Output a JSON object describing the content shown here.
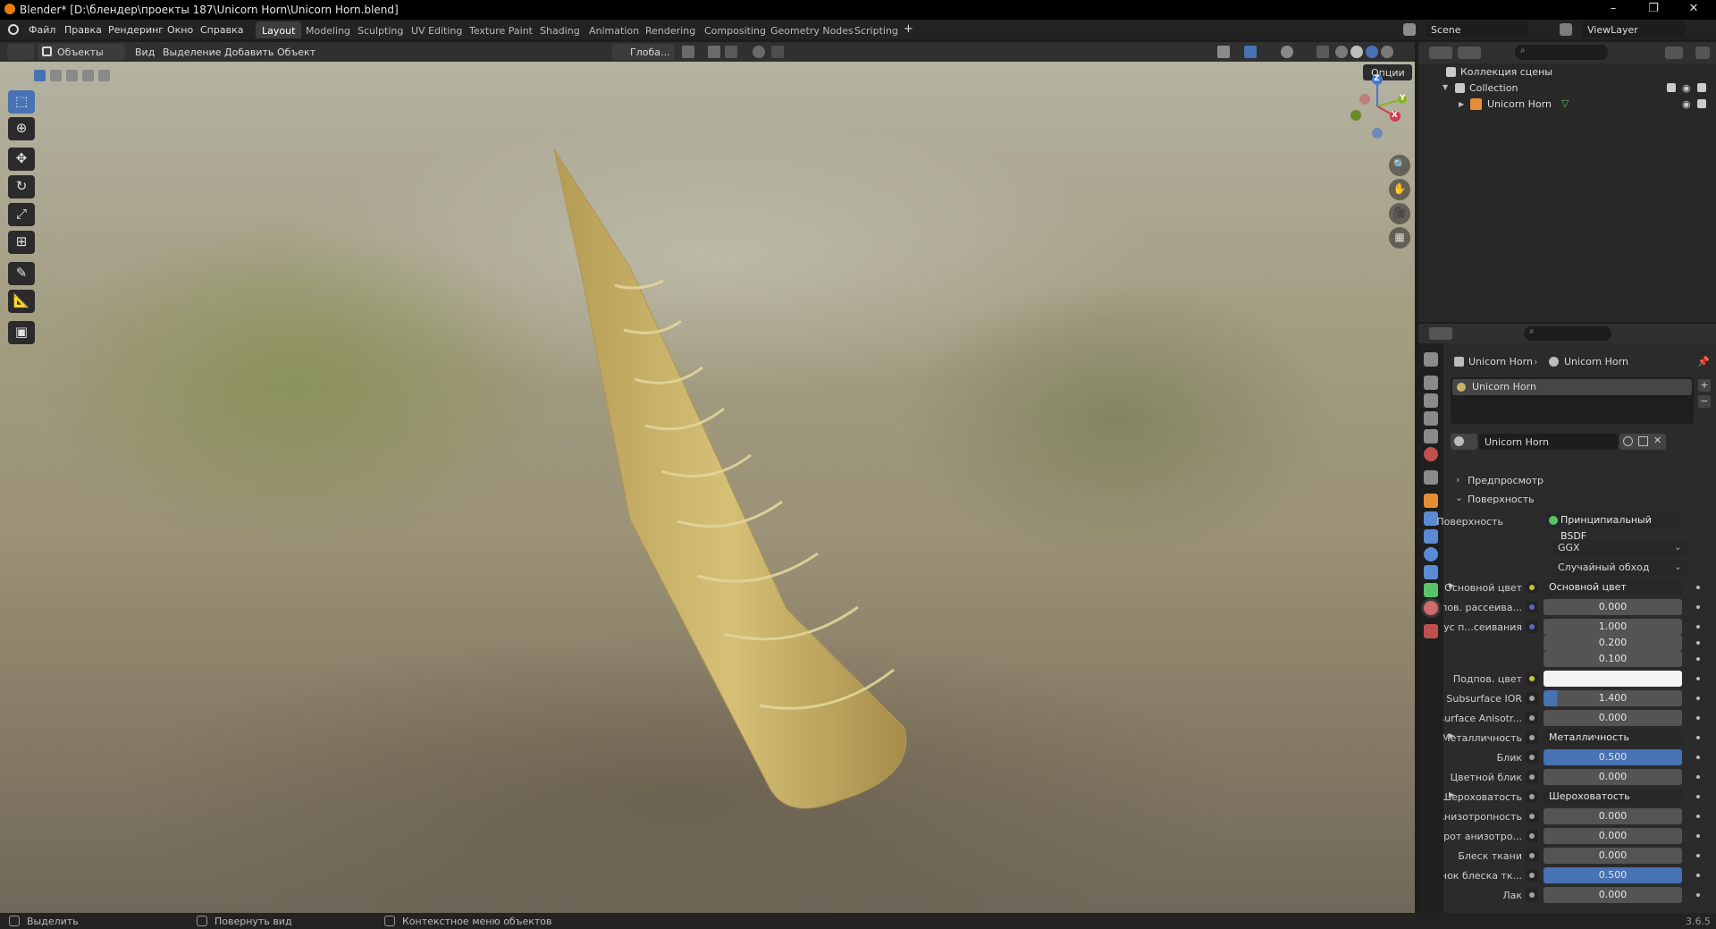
{
  "window": {
    "title": "Blender* [D:\\блендер\\проекты 187\\Unicorn Horn\\Unicorn Horn.blend]",
    "minimize": "–",
    "restore": "❐",
    "close": "✕"
  },
  "menu": [
    "Файл",
    "Правка",
    "Рендеринг",
    "Окно",
    "Справка"
  ],
  "workspaces": [
    {
      "label": "Layout",
      "active": true
    },
    {
      "label": "Modeling",
      "active": false
    },
    {
      "label": "Sculpting",
      "active": false
    },
    {
      "label": "UV Editing",
      "active": false
    },
    {
      "label": "Texture Paint",
      "active": false
    },
    {
      "label": "Shading",
      "active": false
    },
    {
      "label": "Animation",
      "active": false
    },
    {
      "label": "Rendering",
      "active": false
    },
    {
      "label": "Compositing",
      "active": false
    },
    {
      "label": "Geometry Nodes",
      "active": false
    },
    {
      "label": "Scripting",
      "active": false
    }
  ],
  "add_workspace": "+",
  "scene": {
    "label": "Scene",
    "view_layer": "ViewLayer"
  },
  "viewport_header": {
    "mode": "Объекты",
    "menus": [
      "Вид",
      "Выделение",
      "Добавить",
      "Объект"
    ],
    "transform_orientation": "Глоба...",
    "options": "Опции"
  },
  "gizmo": {
    "x": "X",
    "y": "Y",
    "z": "Z"
  },
  "outliner": {
    "root": "Коллекция сцены",
    "collection": "Collection",
    "object": "Unicorn Horn"
  },
  "properties": {
    "breadcrumb_object": "Unicorn Horn",
    "breadcrumb_material": "Unicorn Horn",
    "slot_material": "Unicorn Horn",
    "material_name": "Unicorn Horn",
    "sections": {
      "preview": "Предпросмотр",
      "surface": "Поверхность"
    },
    "surface_label": "Поверхность",
    "surface_value": "Принципиальный BSDF",
    "distribution": "GGX",
    "subsurface_method": "Случайный обход",
    "rows": [
      {
        "label": "Основной цвет",
        "kind": "link",
        "value": "Основной цвет",
        "socket": "#c7c729",
        "expander": true
      },
      {
        "label": "Подпов. рассеива...",
        "kind": "num",
        "value": "0.000",
        "socket": "#6363c7"
      },
      {
        "label": "Радиус п...сеивания",
        "kind": "num",
        "value": "1.000",
        "socket": "#6363c7"
      },
      {
        "label": "",
        "kind": "num",
        "value": "0.200",
        "socket": ""
      },
      {
        "label": "",
        "kind": "num",
        "value": "0.100",
        "socket": ""
      },
      {
        "label": "Подпов. цвет",
        "kind": "color",
        "value": "",
        "socket": "#c7c729"
      },
      {
        "label": "Subsurface IOR",
        "kind": "num",
        "value": "1.400",
        "socket": "#a1a1a1",
        "fill": 0.1
      },
      {
        "label": "Subsurface Anisotr...",
        "kind": "num",
        "value": "0.000",
        "socket": "#a1a1a1"
      },
      {
        "label": "Металличность",
        "kind": "link",
        "value": "Металличность",
        "socket": "#a1a1a1",
        "expander": true
      },
      {
        "label": "Блик",
        "kind": "num",
        "value": "0.500",
        "socket": "#a1a1a1",
        "fill": 1.0
      },
      {
        "label": "Цветной блик",
        "kind": "num",
        "value": "0.000",
        "socket": "#a1a1a1"
      },
      {
        "label": "Шероховатость",
        "kind": "link",
        "value": "Шероховатость",
        "socket": "#a1a1a1",
        "expander": true
      },
      {
        "label": "Анизотропность",
        "kind": "num",
        "value": "0.000",
        "socket": "#a1a1a1"
      },
      {
        "label": "Поворот анизотро...",
        "kind": "num",
        "value": "0.000",
        "socket": "#a1a1a1"
      },
      {
        "label": "Блеск ткани",
        "kind": "num",
        "value": "0.000",
        "socket": "#a1a1a1"
      },
      {
        "label": "Оттенок блеска тк...",
        "kind": "num",
        "value": "0.500",
        "socket": "#a1a1a1",
        "fill": 1.0
      },
      {
        "label": "Лак",
        "kind": "num",
        "value": "0.000",
        "socket": "#a1a1a1"
      }
    ]
  },
  "statusbar": {
    "select": "Выделить",
    "rotate": "Повернуть вид",
    "context": "Контекстное меню объектов",
    "version": "3.6.5"
  },
  "colors": {
    "accent": "#4772b3",
    "horn": "#c9b46a"
  }
}
